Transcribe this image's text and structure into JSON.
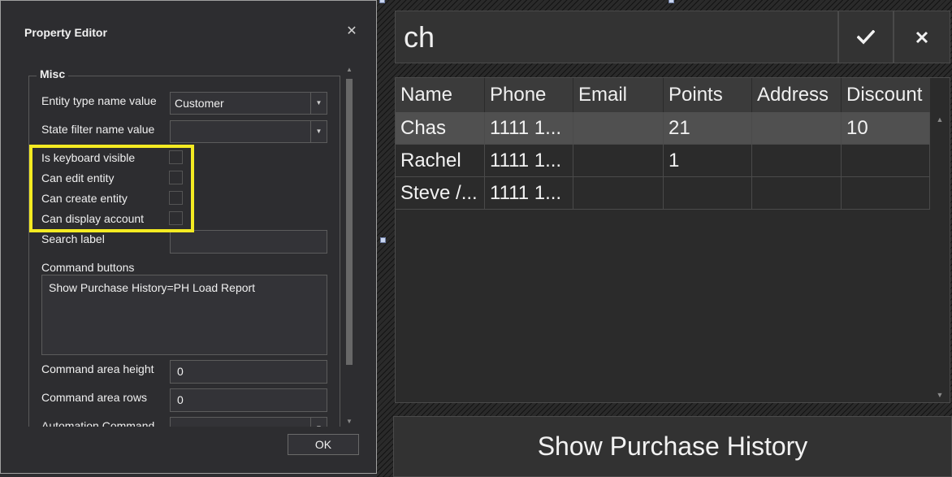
{
  "dialog": {
    "title": "Property Editor",
    "close_icon": "close-icon",
    "group_title": "Misc",
    "props": {
      "entity_type_label": "Entity type name value",
      "entity_type_value": "Customer",
      "state_filter_label": "State filter name value",
      "state_filter_value": "",
      "keyboard_visible_label": "Is keyboard visible",
      "keyboard_visible_checked": false,
      "can_edit_label": "Can edit entity",
      "can_edit_checked": false,
      "can_create_label": "Can create entity",
      "can_create_checked": false,
      "can_display_label": "Can display account",
      "can_display_checked": false,
      "search_label_label": "Search label",
      "search_label_value": "",
      "command_buttons_label": "Command buttons",
      "command_buttons_value": "Show Purchase History=PH Load Report",
      "command_area_height_label": "Command area height",
      "command_area_height_value": "0",
      "command_area_rows_label": "Command area rows",
      "command_area_rows_value": "0",
      "automation_command_label": "Automation Command"
    },
    "ok_label": "OK",
    "highlight_color": "#f4eb22"
  },
  "search": {
    "query": "ch",
    "confirm_icon": "check-icon",
    "clear_icon": "close-icon"
  },
  "grid": {
    "columns": [
      "Name",
      "Phone",
      "Email",
      "Points",
      "Address",
      "Discount"
    ],
    "rows": [
      {
        "name": "Chas",
        "phone": "1111 1...",
        "email": "",
        "points": "21",
        "address": "",
        "discount": "10",
        "selected": true
      },
      {
        "name": "Rachel",
        "phone": "1111 1...",
        "email": "",
        "points": "1",
        "address": "",
        "discount": "",
        "selected": false
      },
      {
        "name": "Steve /...",
        "phone": "1111 1...",
        "email": "",
        "points": "",
        "address": "",
        "discount": "",
        "selected": false
      }
    ]
  },
  "command_button_label": "Show Purchase History"
}
